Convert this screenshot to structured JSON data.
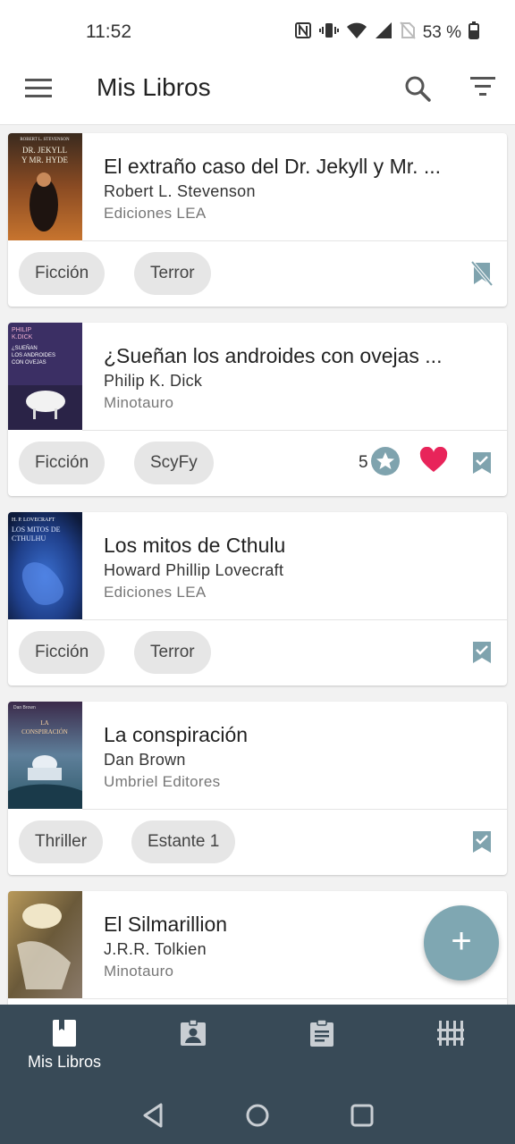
{
  "status_bar": {
    "time": "11:52",
    "battery": "53 %"
  },
  "app_bar": {
    "title": "Mis Libros"
  },
  "books": [
    {
      "title": "El extraño caso del Dr. Jekyll y Mr. ...",
      "author": "Robert L. Stevenson",
      "publisher": "Ediciones LEA",
      "tags": [
        "Ficción",
        "Terror"
      ],
      "cover": {
        "top_text": "ROBERT L. STEVENSON",
        "title_text": "DR. JEKYLL Y MR. HYDE",
        "colors": [
          "#3a2a1e",
          "#8a4b23",
          "#c7742e"
        ]
      },
      "status_icon": "bookmark-off-icon"
    },
    {
      "title": "¿Sueñan los androides con ovejas ...",
      "author": "Philip K. Dick",
      "publisher": "Minotauro",
      "tags": [
        "Ficción",
        "ScyFy"
      ],
      "rating": "5",
      "favorite": true,
      "cover": {
        "top_text": "PHILIP K.DICK",
        "title_text": "¿SUEÑAN LOS ANDROIDES CON OVEJAS ELÉCTRICAS?",
        "colors": [
          "#3b2f64",
          "#5e4a8c",
          "#2a2347"
        ]
      },
      "status_icon": "bookmark-check-icon"
    },
    {
      "title": "Los mitos de Cthulu",
      "author": "Howard Phillip Lovecraft",
      "publisher": "Ediciones LEA",
      "tags": [
        "Ficción",
        "Terror"
      ],
      "cover": {
        "top_text": "H. P. LOVECRAFT",
        "title_text": "LOS MITOS DE CTHULHU",
        "colors": [
          "#0d1a3a",
          "#1f3f8a",
          "#3a6fd0"
        ]
      },
      "status_icon": "bookmark-check-icon"
    },
    {
      "title": "La conspiración",
      "author": "Dan Brown",
      "publisher": "Umbriel Editores",
      "tags": [
        "Thriller",
        "Estante 1"
      ],
      "cover": {
        "top_text": "Dan Brown",
        "title_text": "LA CONSPIRACIÓN",
        "colors": [
          "#3b2a4a",
          "#5e7f9a",
          "#2f5a6a"
        ]
      },
      "status_icon": "bookmark-check-icon"
    },
    {
      "title": "El Silmarillion",
      "author": "J.R.R. Tolkien",
      "publisher": "Minotauro",
      "tags": [],
      "cover": {
        "top_text": "",
        "title_text": "",
        "colors": [
          "#6b5a3a",
          "#b8995a",
          "#8a7a6a"
        ]
      },
      "status_icon": ""
    }
  ],
  "fab": {
    "label": "+"
  },
  "bottom_nav": [
    {
      "label": "Mis Libros",
      "icon": "book-icon",
      "active": true
    },
    {
      "label": "",
      "icon": "contact-card-icon",
      "active": false
    },
    {
      "label": "",
      "icon": "clipboard-icon",
      "active": false
    },
    {
      "label": "",
      "icon": "shelves-icon",
      "active": false
    }
  ],
  "colors": {
    "accent": "#7fa7b2",
    "nav_bg": "#384a57",
    "heart": "#e8245a",
    "chip_bg": "#e6e6e6"
  }
}
